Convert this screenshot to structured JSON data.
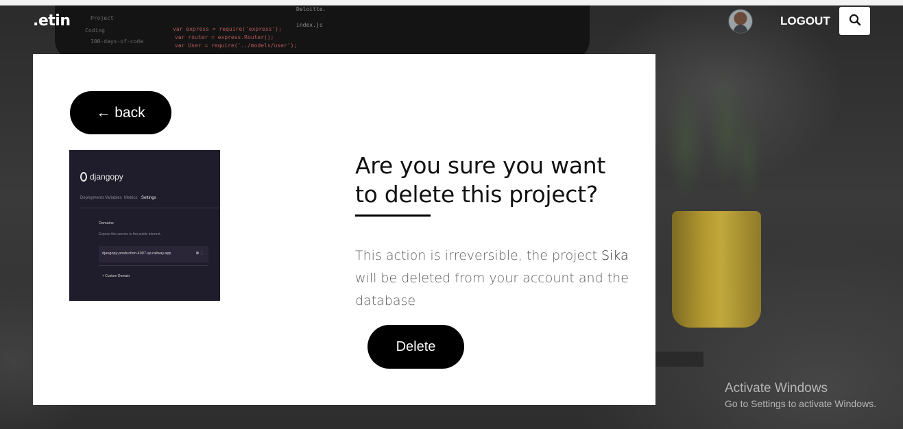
{
  "navbar": {
    "logo": ".etin",
    "logout_label": "LOGOUT",
    "search_icon": "search-icon"
  },
  "background": {
    "code_lines": [
      "var express = require('express');",
      "var router = express.Router();",
      "var User = require('../models/user');"
    ],
    "project_tree": [
      "Project",
      "Coding",
      "100-days-of-code"
    ],
    "editor_tab": "index.js",
    "window_title": "Deloitte."
  },
  "card": {
    "back_label": "← back",
    "thumbnail": {
      "project_name": "djangopy",
      "tabs": [
        "Deployments",
        "Variables",
        "Metrics",
        "Settings"
      ],
      "active_tab": "Settings",
      "section_title": "Domains",
      "section_desc": "Expose this service to the public internet.",
      "domain": "djangopy-production-4007.up.railway.app",
      "custom_domain_label": "+ Custom Domain"
    },
    "heading": "Are you sure you want to delete this project?",
    "message_prefix": "This action is irreversible, the project ",
    "project_name": "Sika",
    "message_suffix": " will be deleted from your account and the database",
    "delete_label": "Delete"
  },
  "watermark": {
    "title": "Activate Windows",
    "subtitle": "Go to Settings to activate Windows."
  }
}
